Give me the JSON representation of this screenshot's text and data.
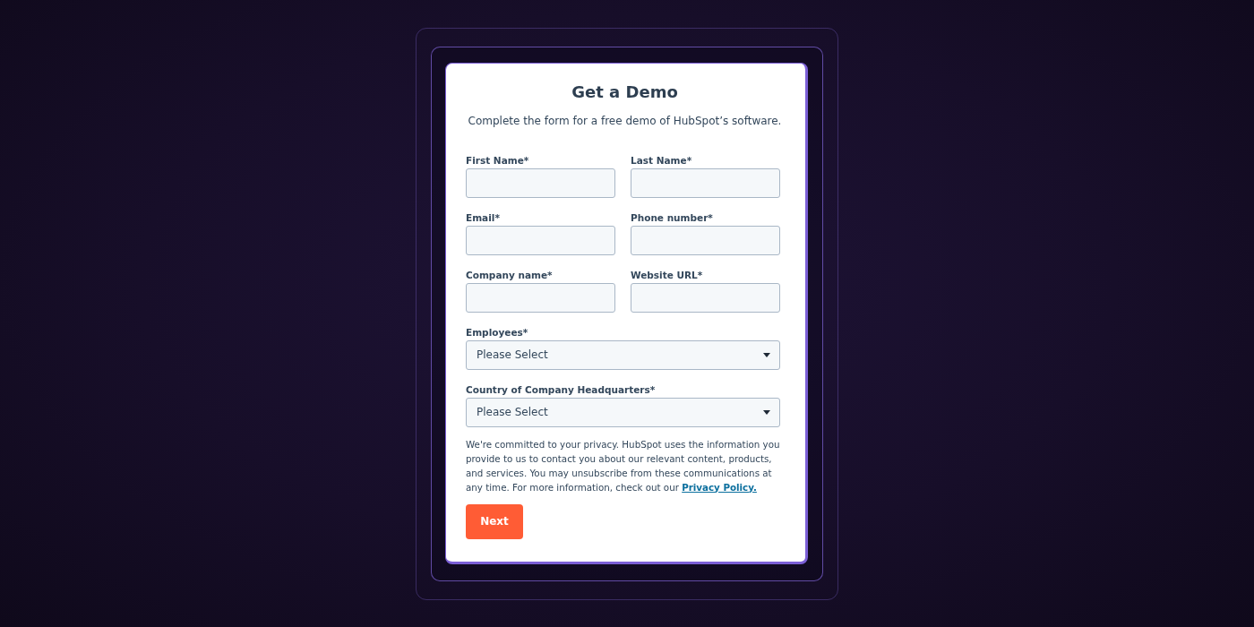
{
  "form": {
    "title": "Get a Demo",
    "subtitle": "Complete the form for a free demo of HubSpot’s software.",
    "fields": [
      {
        "kind": "text",
        "label": "First Name*"
      },
      {
        "kind": "text",
        "label": "Last Name*"
      },
      {
        "kind": "text",
        "label": "Email*"
      },
      {
        "kind": "text",
        "label": "Phone number*"
      },
      {
        "kind": "text",
        "label": "Company name*"
      },
      {
        "kind": "text",
        "label": "Website URL*"
      },
      {
        "kind": "select",
        "label": "Employees*",
        "placeholder": "Please Select"
      },
      {
        "kind": "select",
        "label": "Country of Company Headquarters*",
        "placeholder": "Please Select"
      }
    ],
    "privacy": {
      "text": "We're committed to your privacy. HubSpot uses the information you provide to us to contact you about our relevant content, products, and services. You may unsubscribe from these communications at any time. For more information, check out our",
      "link": "Privacy Policy."
    },
    "submit": "Next"
  }
}
